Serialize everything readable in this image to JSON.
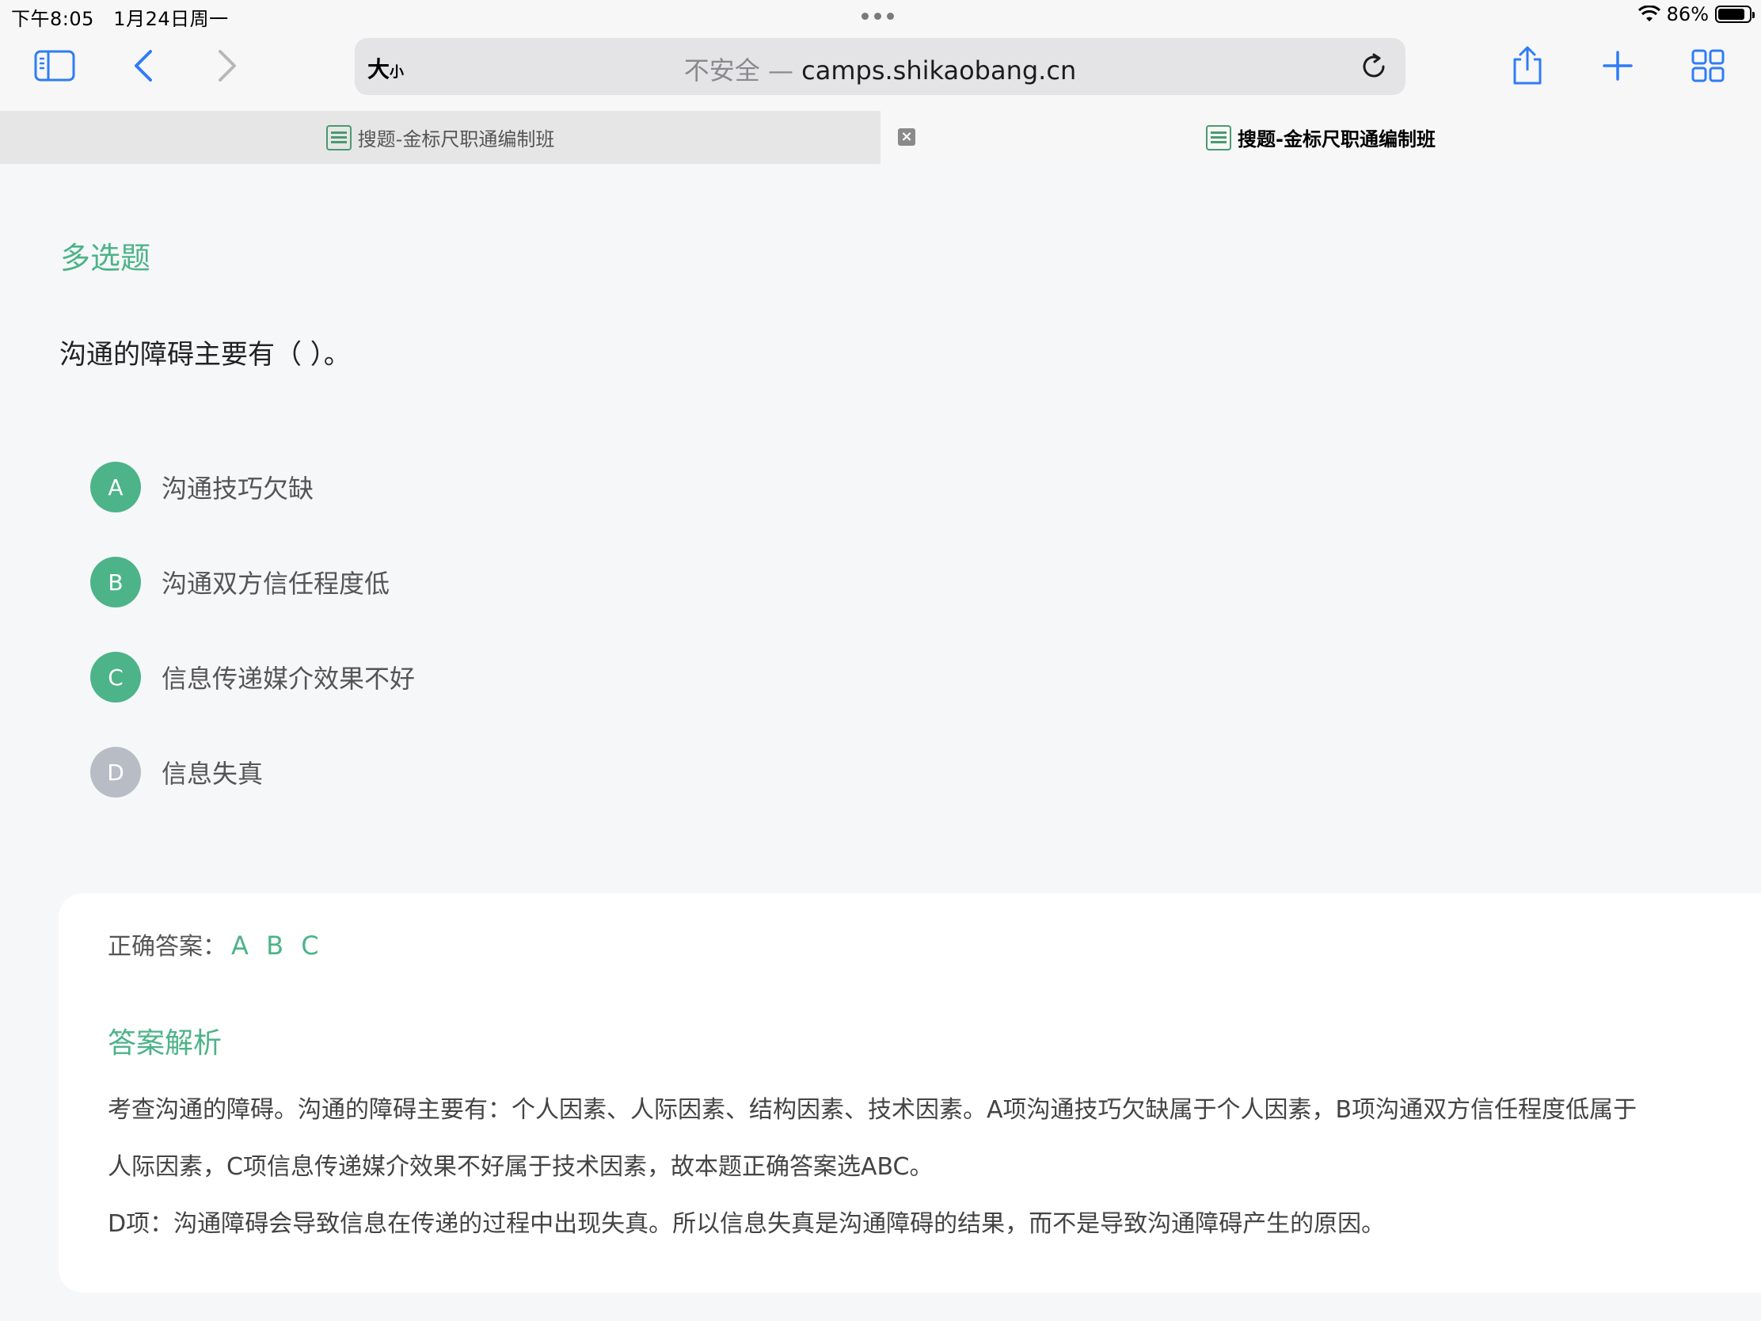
{
  "status": {
    "time": "下午8:05",
    "date": "1月24日周一",
    "battery": "86%",
    "battery_level": 0.86
  },
  "toolbar": {
    "text_size_big": "大",
    "text_size_small": "小",
    "url_insecure": "不安全",
    "url_separator": " — ",
    "url_domain": "camps.shikaobang.cn"
  },
  "tabs": [
    {
      "label": "搜题-金标尺职通编制班",
      "active": false
    },
    {
      "label": "搜题-金标尺职通编制班",
      "active": true
    }
  ],
  "question": {
    "type": "多选题",
    "stem": "沟通的障碍主要有（ ）。",
    "options": [
      {
        "letter": "A",
        "text": "沟通技巧欠缺",
        "correct": true
      },
      {
        "letter": "B",
        "text": "沟通双方信任程度低",
        "correct": true
      },
      {
        "letter": "C",
        "text": "信息传递媒介效果不好",
        "correct": true
      },
      {
        "letter": "D",
        "text": "信息失真",
        "correct": false
      }
    ]
  },
  "answer": {
    "label": "正确答案：",
    "value": "A B C",
    "analysis_title": "答案解析",
    "analysis_lines": [
      "考查沟通的障碍。沟通的障碍主要有：个人因素、人际因素、结构因素、技术因素。A项沟通技巧欠缺属于个人因素，B项沟通双方信任程度低属于",
      "人际因素，C项信息传递媒介效果不好属于技术因素，故本题正确答案选ABC。",
      "D项：沟通障碍会导致信息在传递的过程中出现失真。所以信息失真是沟通障碍的结果，而不是导致沟通障碍产生的原因。"
    ]
  },
  "colors": {
    "accent": "#4db389",
    "wrong_option": "#b8bcc4"
  }
}
